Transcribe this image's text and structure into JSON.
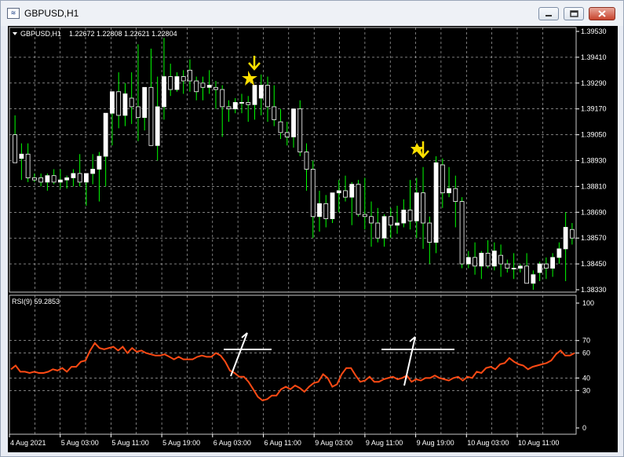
{
  "window": {
    "title": "GBPUSD,H1",
    "app_icon_glyph": "≋"
  },
  "chart_header": {
    "symbol": "GBPUSD,H1",
    "ohlc": "1.22672 1.22808 1.22621 1.22804"
  },
  "price_axis": {
    "labels": [
      "1.39530",
      "1.39410",
      "1.39290",
      "1.39170",
      "1.39050",
      "1.38930",
      "1.38810",
      "1.38690",
      "1.38570",
      "1.38450",
      "1.38330"
    ]
  },
  "rsi_panel": {
    "label": "RSI(9) 59.2853",
    "levels": [
      "100",
      "70",
      "60",
      "40",
      "30",
      "0"
    ]
  },
  "time_axis": {
    "labels": [
      "4 Aug 2021",
      "5 Aug 03:00",
      "5 Aug 11:00",
      "5 Aug 19:00",
      "6 Aug 03:00",
      "6 Aug 11:00",
      "9 Aug 03:00",
      "9 Aug 11:00",
      "9 Aug 19:00",
      "10 Aug 03:00",
      "10 Aug 11:00"
    ]
  },
  "colors": {
    "background": "#000000",
    "grid": "#c8c8c8",
    "bull_candle": "#ffffff",
    "bear_candle": "#ffffff",
    "wick": "#00ff00",
    "rsi_line": "#ff4a14",
    "arrow": "#ffe000",
    "annotation": "#ffffff"
  },
  "chart_data": {
    "type": "candlestick",
    "price_range": [
      1.3833,
      1.3953
    ],
    "candles": [
      [
        1.3905,
        1.3914,
        1.3893,
        1.3892
      ],
      [
        1.3894,
        1.3901,
        1.3884,
        1.3896
      ],
      [
        1.3896,
        1.3901,
        1.3883,
        1.3885
      ],
      [
        1.3885,
        1.3887,
        1.3883,
        1.3884
      ],
      [
        1.3885,
        1.3887,
        1.3881,
        1.3883
      ],
      [
        1.3883,
        1.3887,
        1.3879,
        1.3886
      ],
      [
        1.3886,
        1.3889,
        1.3882,
        1.3883
      ],
      [
        1.3883,
        1.3889,
        1.388,
        1.3884
      ],
      [
        1.3884,
        1.3886,
        1.388,
        1.3885
      ],
      [
        1.3885,
        1.3889,
        1.3881,
        1.3887
      ],
      [
        1.3887,
        1.3896,
        1.3881,
        1.3883
      ],
      [
        1.3883,
        1.3887,
        1.3872,
        1.3887
      ],
      [
        1.3887,
        1.3896,
        1.3882,
        1.3889
      ],
      [
        1.3889,
        1.3897,
        1.3874,
        1.3895
      ],
      [
        1.3895,
        1.3904,
        1.3881,
        1.3915
      ],
      [
        1.3915,
        1.3924,
        1.39,
        1.3925
      ],
      [
        1.3925,
        1.3934,
        1.3908,
        1.3914
      ],
      [
        1.3914,
        1.3929,
        1.3909,
        1.3924
      ],
      [
        1.3922,
        1.3934,
        1.391,
        1.3918
      ],
      [
        1.3918,
        1.3947,
        1.3902,
        1.3913
      ],
      [
        1.3913,
        1.3927,
        1.3907,
        1.3927
      ],
      [
        1.3927,
        1.3945,
        1.3903,
        1.39
      ],
      [
        1.39,
        1.3932,
        1.3893,
        1.3918
      ],
      [
        1.3918,
        1.395,
        1.3912,
        1.3932
      ],
      [
        1.3932,
        1.3938,
        1.3923,
        1.3926
      ],
      [
        1.3926,
        1.3934,
        1.3925,
        1.3932
      ],
      [
        1.3932,
        1.3935,
        1.3924,
        1.393
      ],
      [
        1.3935,
        1.394,
        1.3925,
        1.393
      ],
      [
        1.393,
        1.3932,
        1.3921,
        1.3925
      ],
      [
        1.3929,
        1.3932,
        1.3921,
        1.3927
      ],
      [
        1.3927,
        1.3935,
        1.3924,
        1.3928
      ],
      [
        1.3927,
        1.393,
        1.3917,
        1.3926
      ],
      [
        1.3926,
        1.3928,
        1.3904,
        1.3918
      ],
      [
        1.3918,
        1.3921,
        1.3911,
        1.3917
      ],
      [
        1.3917,
        1.3922,
        1.3915,
        1.392
      ],
      [
        1.392,
        1.3924,
        1.3915,
        1.392
      ],
      [
        1.392,
        1.3923,
        1.3911,
        1.3919
      ],
      [
        1.3919,
        1.3925,
        1.3912,
        1.3928
      ],
      [
        1.3922,
        1.3933,
        1.3914,
        1.3928
      ],
      [
        1.3928,
        1.3932,
        1.3911,
        1.3918
      ],
      [
        1.3918,
        1.3928,
        1.3909,
        1.3912
      ],
      [
        1.3911,
        1.3917,
        1.3903,
        1.3906
      ],
      [
        1.3906,
        1.3911,
        1.39,
        1.3904
      ],
      [
        1.3904,
        1.3915,
        1.3899,
        1.3917
      ],
      [
        1.3917,
        1.3921,
        1.3895,
        1.3897
      ],
      [
        1.3897,
        1.3901,
        1.3879,
        1.3889
      ],
      [
        1.3889,
        1.3893,
        1.3857,
        1.3867
      ],
      [
        1.3867,
        1.3879,
        1.386,
        1.3873
      ],
      [
        1.3873,
        1.3877,
        1.3862,
        1.3866
      ],
      [
        1.3866,
        1.3877,
        1.3864,
        1.3878
      ],
      [
        1.3878,
        1.3884,
        1.3869,
        1.3879
      ],
      [
        1.3879,
        1.3886,
        1.3874,
        1.3876
      ],
      [
        1.3876,
        1.3883,
        1.3863,
        1.3882
      ],
      [
        1.3882,
        1.3884,
        1.3867,
        1.3868
      ],
      [
        1.3868,
        1.3885,
        1.3861,
        1.3867
      ],
      [
        1.3867,
        1.3874,
        1.3853,
        1.3864
      ],
      [
        1.3864,
        1.3871,
        1.3855,
        1.3857
      ],
      [
        1.3857,
        1.3868,
        1.3853,
        1.3867
      ],
      [
        1.3867,
        1.3871,
        1.3857,
        1.3863
      ],
      [
        1.3863,
        1.3872,
        1.3859,
        1.3864
      ],
      [
        1.3864,
        1.3875,
        1.3862,
        1.387
      ],
      [
        1.387,
        1.3884,
        1.3861,
        1.3865
      ],
      [
        1.3865,
        1.3885,
        1.3857,
        1.3878
      ],
      [
        1.3878,
        1.389,
        1.3852,
        1.3864
      ],
      [
        1.3864,
        1.3867,
        1.3845,
        1.3855
      ],
      [
        1.3855,
        1.3895,
        1.385,
        1.3892
      ],
      [
        1.3891,
        1.3894,
        1.3871,
        1.3878
      ],
      [
        1.3878,
        1.389,
        1.3876,
        1.388
      ],
      [
        1.388,
        1.3886,
        1.3862,
        1.3874
      ],
      [
        1.3874,
        1.3876,
        1.3843,
        1.3845
      ],
      [
        1.3845,
        1.3851,
        1.3843,
        1.3848
      ],
      [
        1.3848,
        1.3855,
        1.384,
        1.3844
      ],
      [
        1.3844,
        1.3851,
        1.3838,
        1.385
      ],
      [
        1.385,
        1.3856,
        1.3843,
        1.3844
      ],
      [
        1.3844,
        1.3855,
        1.3842,
        1.3851
      ],
      [
        1.3849,
        1.3854,
        1.3839,
        1.3845
      ],
      [
        1.3845,
        1.3847,
        1.3841,
        1.3843
      ],
      [
        1.3843,
        1.385,
        1.3838,
        1.3843
      ],
      [
        1.3843,
        1.3845,
        1.3841,
        1.3844
      ],
      [
        1.3844,
        1.385,
        1.3837,
        1.3836
      ],
      [
        1.3836,
        1.3842,
        1.3833,
        1.384
      ],
      [
        1.3841,
        1.3846,
        1.3837,
        1.3845
      ],
      [
        1.3845,
        1.3848,
        1.3838,
        1.3843
      ],
      [
        1.3843,
        1.385,
        1.3839,
        1.3848
      ],
      [
        1.3848,
        1.3855,
        1.3845,
        1.3852
      ],
      [
        1.3852,
        1.3869,
        1.3837,
        1.3862
      ],
      [
        1.3861,
        1.3864,
        1.3854,
        1.3857
      ]
    ],
    "rsi": [
      47,
      50,
      45,
      45,
      44,
      45,
      44,
      44,
      45,
      47,
      46,
      48,
      45,
      49,
      49,
      53,
      54,
      62,
      68,
      64,
      63,
      64,
      65,
      62,
      65,
      60,
      64,
      61,
      62,
      60,
      59,
      58,
      58,
      59,
      57,
      55,
      57,
      55,
      55,
      55,
      57,
      58,
      57,
      57,
      60,
      58,
      53,
      46,
      44,
      41,
      41,
      37,
      31,
      25,
      22,
      23,
      26,
      26,
      31,
      33,
      31,
      34,
      32,
      29,
      33,
      36,
      37,
      43,
      40,
      33,
      35,
      43,
      48,
      48,
      42,
      37,
      38,
      41,
      37,
      37,
      39,
      40,
      41,
      39,
      40,
      42,
      37,
      39,
      38,
      40,
      40,
      42,
      40,
      39,
      38,
      40,
      41,
      38,
      41,
      40,
      45,
      44,
      48,
      49,
      47,
      51,
      52,
      56,
      53,
      51,
      50,
      47,
      49,
      50,
      51,
      52,
      54,
      59,
      62,
      58,
      58,
      60
    ]
  }
}
